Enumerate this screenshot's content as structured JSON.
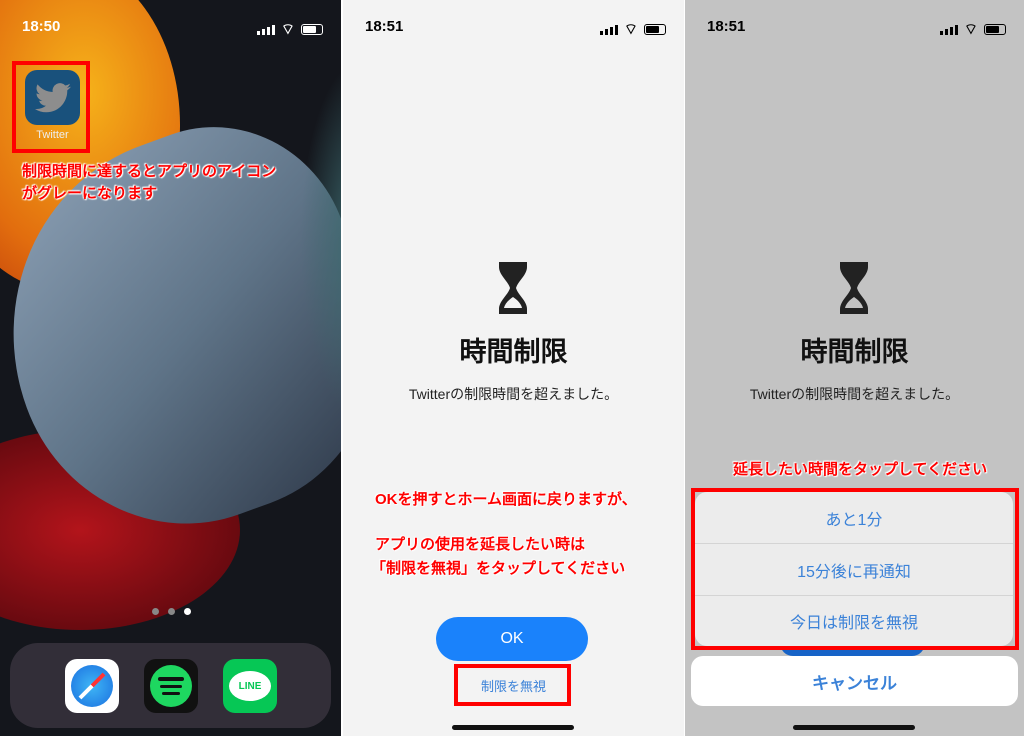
{
  "panel1": {
    "time": "18:50",
    "app_label": "Twitter",
    "annotation_lines": [
      "制限時間に達するとアプリのアイコン",
      "がグレーになります"
    ],
    "dock": [
      "safari-icon",
      "spotify-icon",
      "line-icon"
    ],
    "line_label": "LINE",
    "page_dots": 3,
    "active_page": 3
  },
  "panel2": {
    "time": "18:51",
    "title": "時間制限",
    "subtitle": "Twitterの制限時間を超えました。",
    "annotation_lines": [
      "OKを押すとホーム画面に戻りますが、",
      "アプリの使用を延長したい時は",
      "「制限を無視」をタップしてください"
    ],
    "ok_label": "OK",
    "ignore_label": "制限を無視"
  },
  "panel3": {
    "time": "18:51",
    "title": "時間制限",
    "subtitle": "Twitterの制限時間を超えました。",
    "annotation": "延長したい時間をタップしてください",
    "options": [
      "あと1分",
      "15分後に再通知",
      "今日は制限を無視"
    ],
    "cancel_label": "キャンセル"
  },
  "colors": {
    "accent": "#1a82fb",
    "annotation": "#ff0000",
    "link": "#3b82d8"
  }
}
